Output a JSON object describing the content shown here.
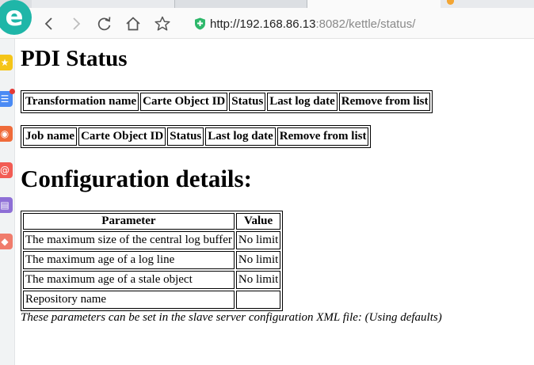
{
  "browser": {
    "logo_glyph": "e",
    "url_host": "http://192.168.86.13",
    "url_rest": ":8082/kettle/status/",
    "accent": "#1fb6a8",
    "secure_color": "#2eb86b"
  },
  "sidebar": {
    "icons": [
      {
        "name": "favorites-star-icon",
        "color": "#f5c518"
      },
      {
        "name": "list-app-icon",
        "color": "#4a8af4"
      },
      {
        "name": "weibo-icon",
        "color": "#ef6b3a"
      },
      {
        "name": "email-icon",
        "color": "#f25c54"
      },
      {
        "name": "book-icon",
        "color": "#8e6fd6"
      },
      {
        "name": "game-icon",
        "color": "#f07c6c"
      }
    ]
  },
  "page": {
    "title": "PDI Status",
    "transformations_table": {
      "headers": [
        "Transformation name",
        "Carte Object ID",
        "Status",
        "Last log date",
        "Remove from list"
      ]
    },
    "jobs_table": {
      "headers": [
        "Job name",
        "Carte Object ID",
        "Status",
        "Last log date",
        "Remove from list"
      ]
    },
    "config_title": "Configuration details:",
    "config_table": {
      "headers": [
        "Parameter",
        "Value"
      ],
      "rows": [
        [
          "The maximum size of the central log buffer",
          "No limit"
        ],
        [
          "The maximum age of a log line",
          "No limit"
        ],
        [
          "The maximum age of a stale object",
          "No limit"
        ],
        [
          "Repository name",
          ""
        ]
      ]
    },
    "note": "These parameters can be set in the slave server configuration XML file: (Using defaults)"
  }
}
